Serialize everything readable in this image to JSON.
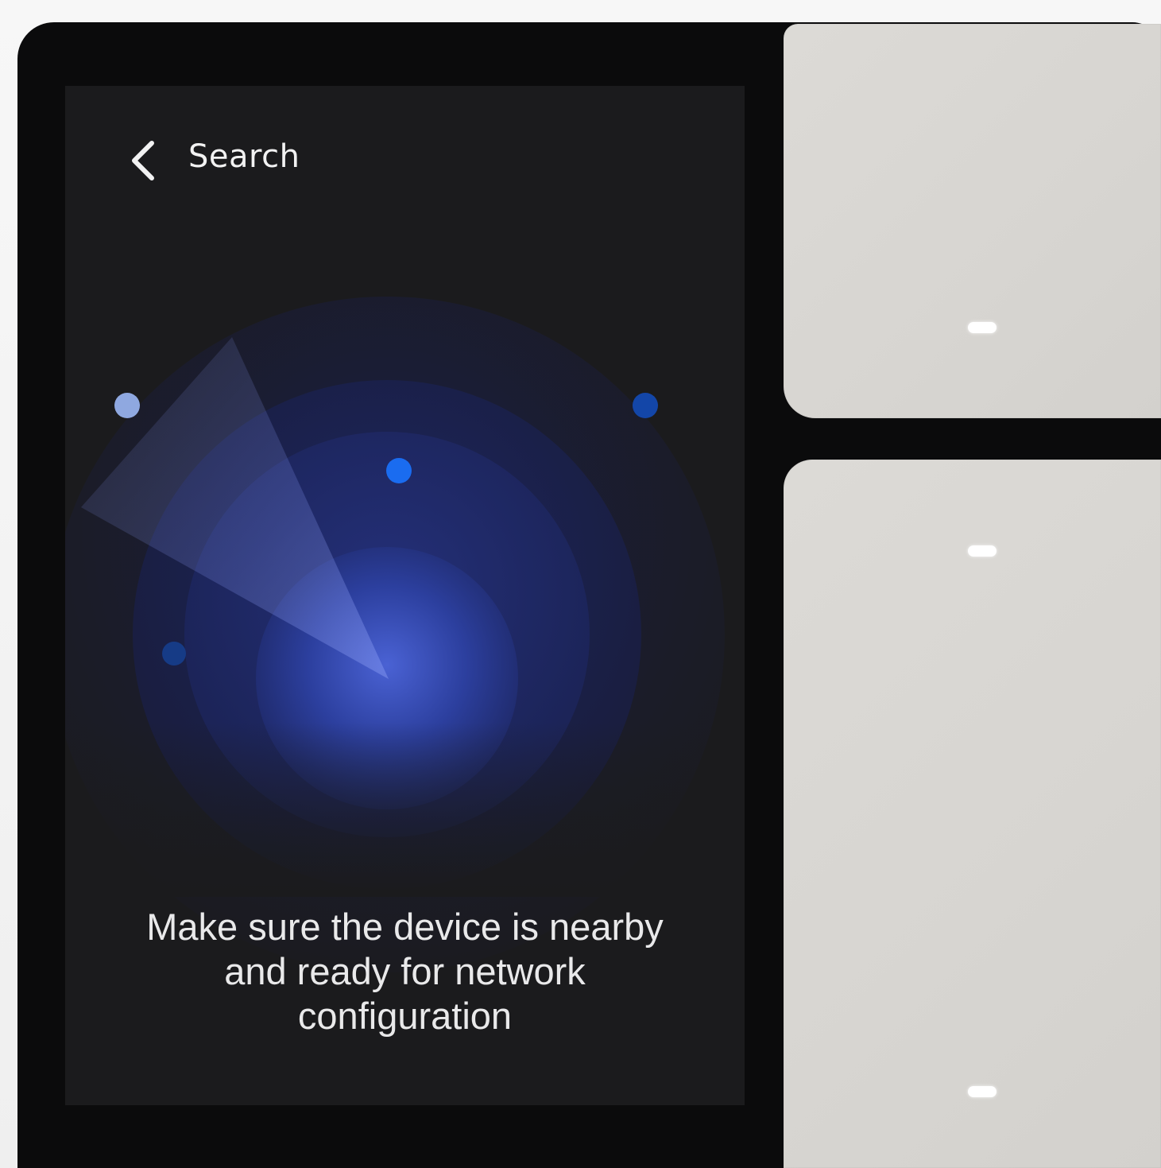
{
  "header": {
    "title": "Search"
  },
  "message": {
    "line1": "Make sure the device is nearby",
    "line2": "and ready for network",
    "line3": "configuration"
  },
  "icons": {
    "back": "chevron-left-icon",
    "indicator": "led-indicator-icon"
  },
  "colors": {
    "bezel": "#0b0b0c",
    "screen_background": "#1b1b1d",
    "text": "#f2f2f2",
    "radar_core": "#3a54c4",
    "device_dot_bright": "#1a6cf0",
    "device_dot_light": "#8fa8e0",
    "device_dot_dim": "#1346a8",
    "switch_panel": "#d9d7d3",
    "indicator_light": "#ffffff"
  }
}
